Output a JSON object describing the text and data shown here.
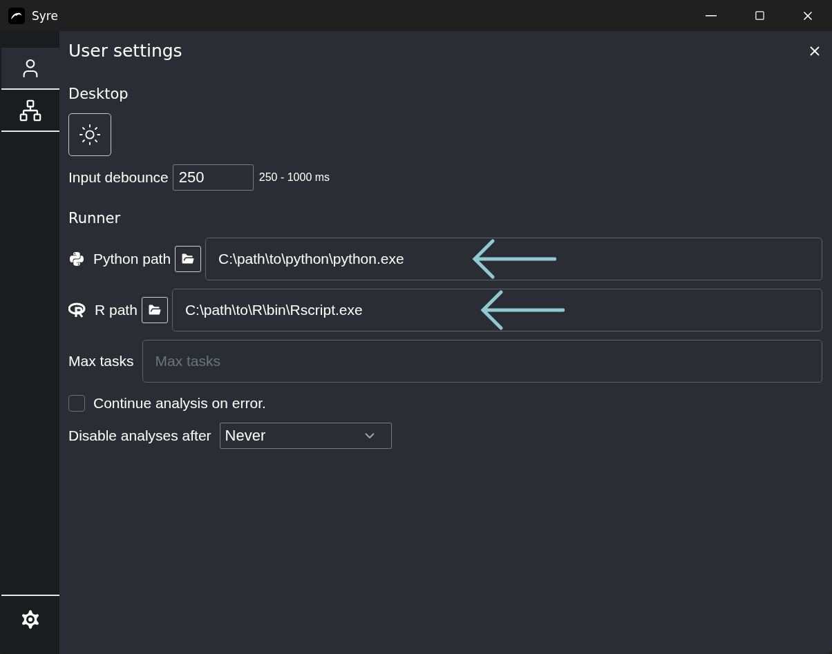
{
  "window": {
    "title": "Syre"
  },
  "sidebar": {
    "tabs": [
      {
        "kind": "user",
        "selected": true
      },
      {
        "kind": "tree",
        "selected": false
      }
    ]
  },
  "settings": {
    "title": "User settings",
    "desktop": {
      "heading": "Desktop",
      "theme_dark": false,
      "debounce_label": "Input debounce",
      "debounce_value": "250",
      "debounce_hint": "250 - 1000 ms"
    },
    "runner": {
      "heading": "Runner",
      "paths": [
        {
          "kind": "python",
          "label": "Python path",
          "value": "C:\\path\\to\\python\\python.exe"
        },
        {
          "kind": "r",
          "label": "R path",
          "value": "C:\\path\\to\\R\\bin\\Rscript.exe"
        }
      ],
      "max_tasks_label": "Max tasks",
      "max_tasks_placeholder": "Max tasks",
      "continue_label": "Continue analysis on error.",
      "continue_checked": false,
      "disable_label": "Disable analyses after",
      "disable_value": "Never"
    }
  }
}
